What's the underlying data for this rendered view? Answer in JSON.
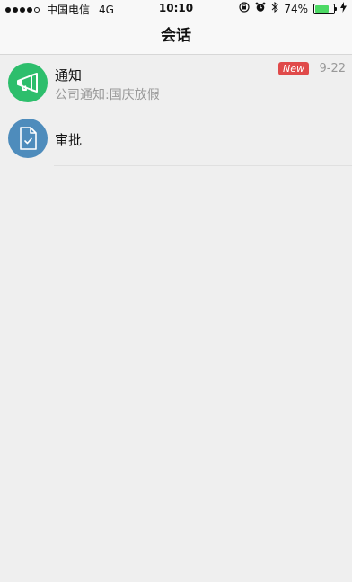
{
  "status_bar": {
    "carrier": "中国电信",
    "network": "4G",
    "time": "10:10",
    "battery_percent": "74%",
    "battery_level": 0.74,
    "icons": [
      "signal-icon",
      "lock-rotation-icon",
      "alarm-icon",
      "bluetooth-icon",
      "charging-icon"
    ]
  },
  "nav": {
    "title": "会话"
  },
  "conversations": [
    {
      "title": "通知",
      "subtitle": "公司通知:国庆放假",
      "badge": "New",
      "date": "9-22",
      "icon": "megaphone-icon",
      "avatar_color": "#2dbe6c"
    },
    {
      "title": "审批",
      "icon": "document-check-icon",
      "avatar_color": "#4e8cbc"
    }
  ]
}
